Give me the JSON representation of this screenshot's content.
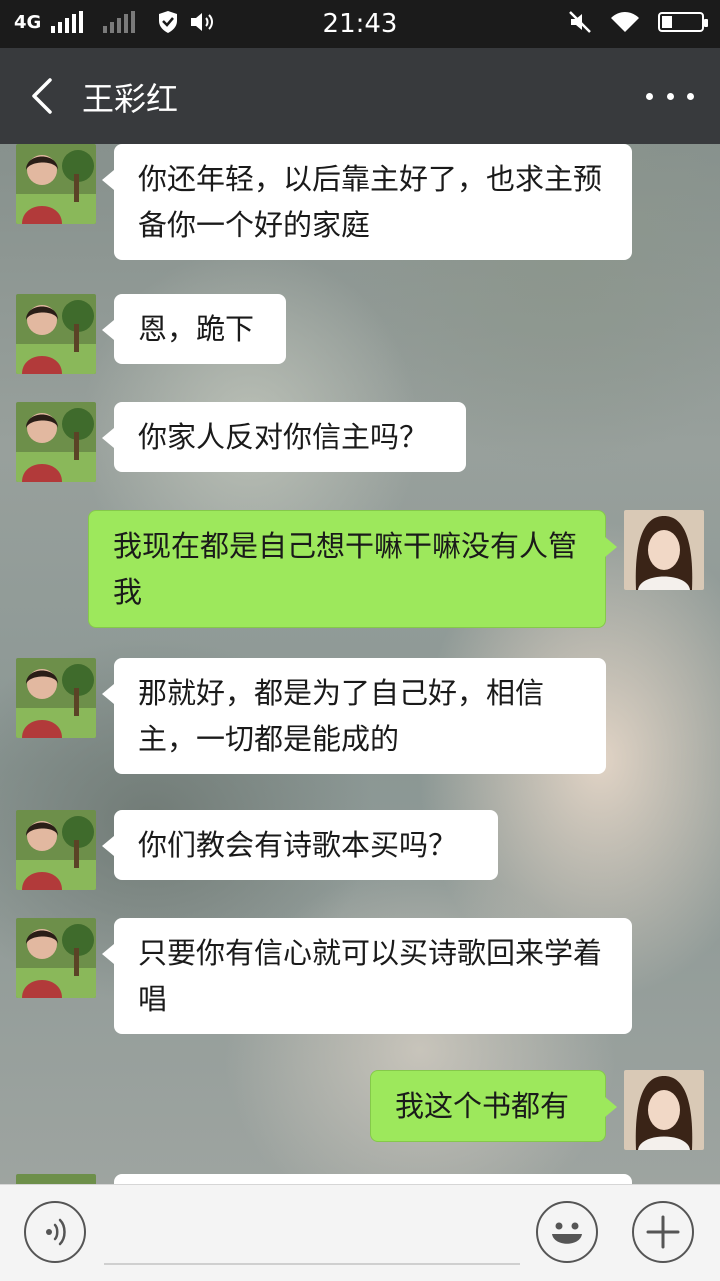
{
  "status_bar": {
    "network": "4G",
    "time": "21:43"
  },
  "header": {
    "title": "王彩红"
  },
  "messages": [
    {
      "sender": "peer",
      "text": "你还年轻，以后靠主好了，也求主预备你一个好的家庭"
    },
    {
      "sender": "peer",
      "text": "恩，跪下"
    },
    {
      "sender": "peer",
      "text": "你家人反对你信主吗？"
    },
    {
      "sender": "me",
      "text": "我现在都是自己想干嘛干嘛没有人管我"
    },
    {
      "sender": "peer",
      "text": "那就好，都是为了自己好，相信主，一切都是能成的"
    },
    {
      "sender": "peer",
      "text": "你们教会有诗歌本买吗？"
    },
    {
      "sender": "peer",
      "text": "只要你有信心就可以买诗歌回来学着唱"
    },
    {
      "sender": "me",
      "text": "我这个书都有"
    }
  ],
  "colors": {
    "sent_bubble": "#9de85c",
    "received_bubble": "#ffffff",
    "title_bar": "#383a3d",
    "status_bar": "#1b1b1b"
  },
  "icons": {
    "back": "chevron-left-icon",
    "more": "more-dots-icon",
    "voice": "voice-icon",
    "emoji": "emoji-icon",
    "plus": "plus-icon"
  }
}
